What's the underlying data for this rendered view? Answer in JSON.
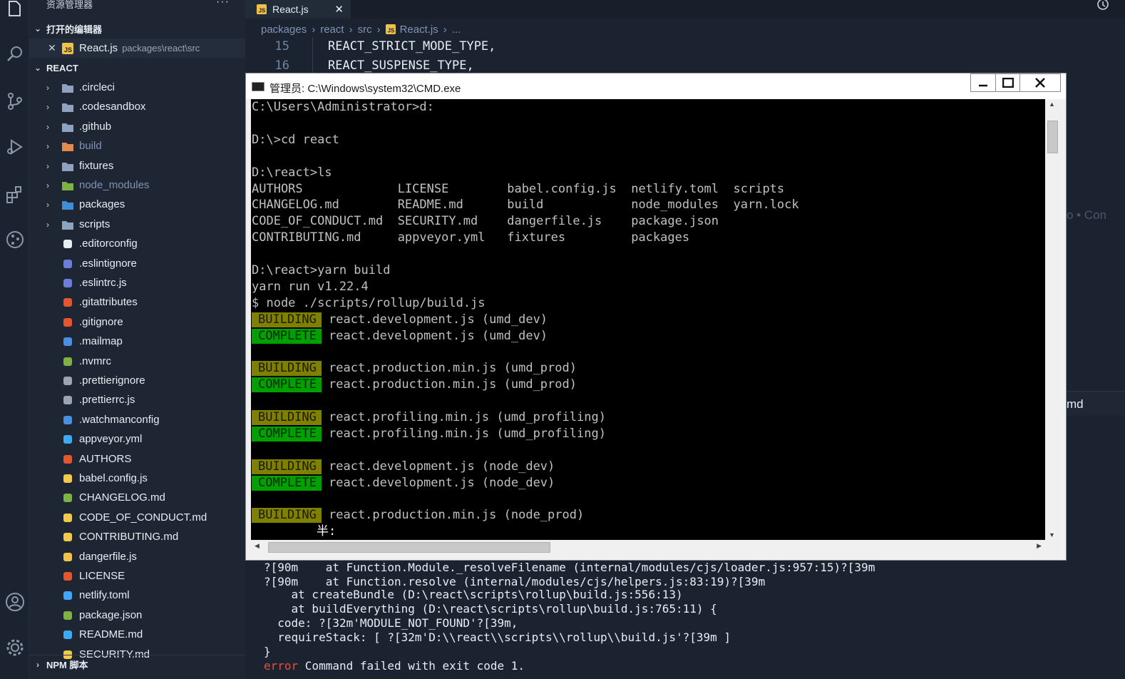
{
  "sidebar": {
    "title": "资源管理器",
    "more": "···",
    "open_editors_label": "打开的编辑器",
    "open_editor": {
      "name": "React.js",
      "path": "packages\\react\\src"
    },
    "project_label": "REACT",
    "folders": [
      {
        "name": ".circleci",
        "icon": "circleci-folder-icon"
      },
      {
        "name": ".codesandbox",
        "icon": "folder-icon"
      },
      {
        "name": ".github",
        "icon": "github-folder-icon"
      },
      {
        "name": "build",
        "icon": "build-folder-icon"
      },
      {
        "name": "fixtures",
        "icon": "folder-icon"
      },
      {
        "name": "node_modules",
        "icon": "node-folder-icon"
      },
      {
        "name": "packages",
        "icon": "packages-folder-icon"
      },
      {
        "name": "scripts",
        "icon": "scripts-folder-icon"
      }
    ],
    "files": [
      {
        "name": ".editorconfig",
        "icon": "editorconfig-icon"
      },
      {
        "name": ".eslintignore",
        "icon": "eslint-icon"
      },
      {
        "name": ".eslintrc.js",
        "icon": "eslint-icon"
      },
      {
        "name": ".gitattributes",
        "icon": "git-icon"
      },
      {
        "name": ".gitignore",
        "icon": "git-icon"
      },
      {
        "name": ".mailmap",
        "icon": "mail-icon"
      },
      {
        "name": ".nvmrc",
        "icon": "nodejs-icon"
      },
      {
        "name": ".prettierignore",
        "icon": "prettier-icon"
      },
      {
        "name": ".prettierrc.js",
        "icon": "prettier-icon"
      },
      {
        "name": ".watchmanconfig",
        "icon": "watchman-icon"
      },
      {
        "name": "appveyor.yml",
        "icon": "appveyor-icon"
      },
      {
        "name": "AUTHORS",
        "icon": "authors-icon"
      },
      {
        "name": "babel.config.js",
        "icon": "babel-icon"
      },
      {
        "name": "CHANGELOG.md",
        "icon": "changelog-icon"
      },
      {
        "name": "CODE_OF_CONDUCT.md",
        "icon": "conduct-icon"
      },
      {
        "name": "CONTRIBUTING.md",
        "icon": "contributing-icon"
      },
      {
        "name": "dangerfile.js",
        "icon": "js-icon"
      },
      {
        "name": "LICENSE",
        "icon": "license-icon"
      },
      {
        "name": "netlify.toml",
        "icon": "netlify-icon"
      },
      {
        "name": "package.json",
        "icon": "nodejs-icon"
      },
      {
        "name": "README.md",
        "icon": "info-icon"
      },
      {
        "name": "SECURITY.md",
        "icon": "lock-icon"
      }
    ],
    "npm_label": "NPM 脚本"
  },
  "editor": {
    "tab_label": "React.js",
    "tab_close": "✕",
    "breadcrumb": [
      "packages",
      "react",
      "src",
      "React.js",
      "..."
    ],
    "lines": [
      {
        "num": "15",
        "text": "REACT_STRICT_MODE_TYPE,"
      },
      {
        "num": "16",
        "text": "REACT_SUSPENSE_TYPE,"
      }
    ],
    "right_peek": "o • Con",
    "right_panel": "md"
  },
  "cmd": {
    "title": "管理员: C:\\Windows\\system32\\CMD.exe",
    "lines": [
      "C:\\Users\\Administrator>d:",
      "",
      "D:\\>cd react",
      "",
      "D:\\react>ls",
      "AUTHORS             LICENSE        babel.config.js  netlify.toml  scripts",
      "CHANGELOG.md        README.md      build            node_modules  yarn.lock",
      "CODE_OF_CONDUCT.md  SECURITY.md    dangerfile.js    package.json",
      "CONTRIBUTING.md     appveyor.yml   fixtures         packages",
      "",
      "D:\\react>yarn build",
      "yarn run v1.22.4",
      "$ node ./scripts/rollup/build.js"
    ],
    "builds": [
      {
        "status": "BUILDING",
        "text": "react.development.js (umd_dev)"
      },
      {
        "status": "COMPLETE",
        "text": "react.development.js (umd_dev)"
      },
      {
        "status": "BUILDING",
        "text": "react.production.min.js (umd_prod)"
      },
      {
        "status": "COMPLETE",
        "text": "react.production.min.js (umd_prod)"
      },
      {
        "status": "BUILDING",
        "text": "react.profiling.min.js (umd_profiling)"
      },
      {
        "status": "COMPLETE",
        "text": "react.profiling.min.js (umd_profiling)"
      },
      {
        "status": "BUILDING",
        "text": "react.development.js (node_dev)"
      },
      {
        "status": "COMPLETE",
        "text": "react.development.js (node_dev)"
      },
      {
        "status": "BUILDING",
        "text": "react.production.min.js (node_prod)"
      }
    ],
    "ime_text": "半:"
  },
  "terminal": {
    "lines": [
      "?[90m    at Function.Module._resolveFilename (internal/modules/cjs/loader.js:957:15)?[39m",
      "?[90m    at Function.resolve (internal/modules/cjs/helpers.js:83:19)?[39m",
      "    at createBundle (D:\\react\\scripts\\rollup\\build.js:556:13)",
      "    at buildEverything (D:\\react\\scripts\\rollup\\build.js:765:11) {",
      "  code: ?[32m'MODULE_NOT_FOUND'?[39m,",
      "  requireStack: [ ?[32m'D:\\\\react\\\\scripts\\\\rollup\\\\build.js'?[39m ]",
      "}"
    ],
    "error_word": "error",
    "error_msg": " Command failed with exit code 1."
  }
}
